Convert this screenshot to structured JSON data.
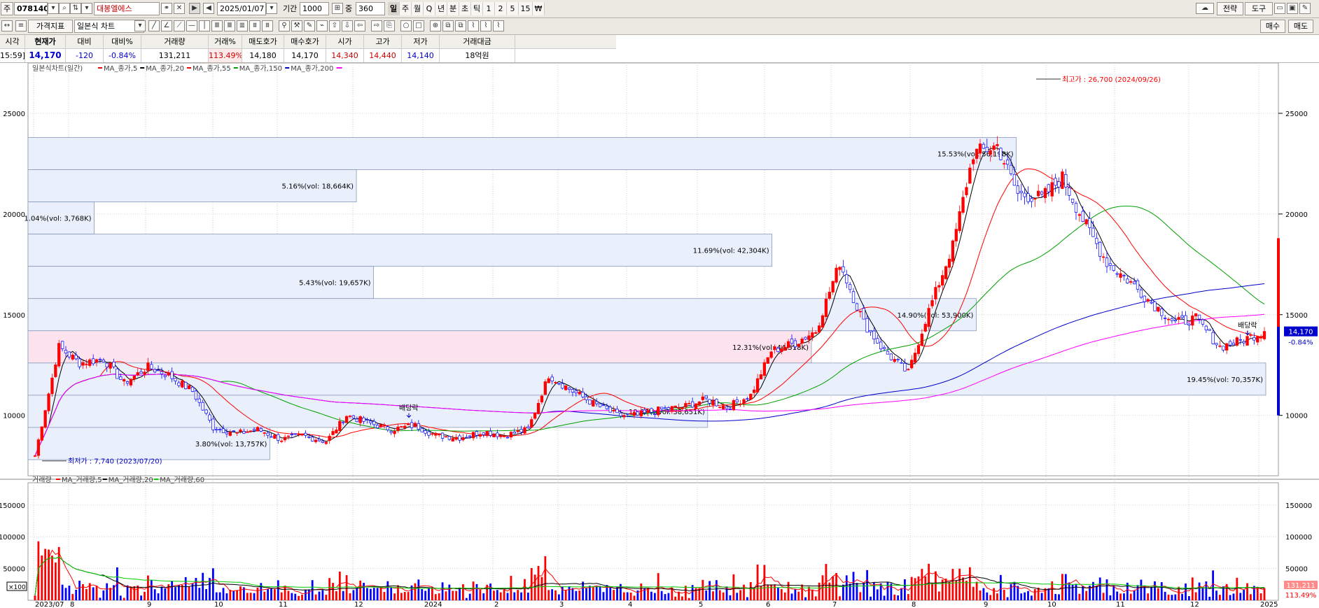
{
  "toolbar": {
    "market_label": "주",
    "code": "078140",
    "stock_name": "대봉엘에스",
    "date": "2025/01/07",
    "period_label": "기간",
    "period_value": "1000",
    "count_label": "중",
    "count_value": "360",
    "period_buttons": [
      "일",
      "주",
      "월",
      "Q",
      "년",
      "분",
      "초",
      "틱",
      "1",
      "2",
      "5",
      "15",
      "₩"
    ],
    "active_period": "일",
    "right_buttons": [
      "전략",
      "도구"
    ]
  },
  "toolbar2": {
    "indicator_label": "가격지표",
    "chart_type": "일본식 차트",
    "buy_label": "매수",
    "sell_label": "매도"
  },
  "quote": {
    "headers": [
      "시각",
      "현재가",
      "대비",
      "대비%",
      "거래량",
      "거래%",
      "매도호가",
      "매수호가",
      "시가",
      "고가",
      "저가",
      "거래대금"
    ],
    "values": [
      "15:59]",
      "14,170",
      "-120",
      "-0.84%",
      "131,211",
      "113.49%",
      "14,180",
      "14,170",
      "14,340",
      "14,440",
      "14,140",
      "18억원"
    ],
    "colors": [
      "#000000",
      "#0000cc",
      "#0000cc",
      "#0000cc",
      "#000000",
      "#cc0000",
      "#000000",
      "#000000",
      "#cc0000",
      "#cc0000",
      "#0000cc",
      "#000000"
    ]
  },
  "price_panel": {
    "title": "일본식차트(일간)",
    "legend": [
      {
        "label": "MA_종가,5",
        "color": "#ff0000"
      },
      {
        "label": "MA_종가,20",
        "color": "#000000"
      },
      {
        "label": "MA_종가,55",
        "color": "#ff0000"
      },
      {
        "label": "MA_종가,150",
        "color": "#00a000"
      },
      {
        "label": "MA_종가,200",
        "color": "#0000cc"
      }
    ],
    "last_series_color": "#ff00ff",
    "price_ticks": [
      "25000",
      "20000",
      "15000",
      "10000"
    ],
    "current_price_tag": "14,170",
    "current_change_tag": "-0.84%",
    "high_annotation": "최고가 : 26,700 (2024/09/26)",
    "low_annotation": "최저가 : 7,740 (2023/07/20)",
    "dividend_label": "배당락",
    "volume_profile": [
      {
        "text": "15.53%(vol: 56,198K)",
        "price_low": 22200,
        "price_high": 23800,
        "highlight": false
      },
      {
        "text": "5.16%(vol: 18,664K)",
        "price_low": 20600,
        "price_high": 22200,
        "highlight": false
      },
      {
        "text": "1.04%(vol: 3,768K)",
        "price_low": 19000,
        "price_high": 20600,
        "highlight": false
      },
      {
        "text": "11.69%(vol: 42,304K)",
        "price_low": 17400,
        "price_high": 19000,
        "highlight": false
      },
      {
        "text": "5.43%(vol: 19,657K)",
        "price_low": 15800,
        "price_high": 17400,
        "highlight": false
      },
      {
        "text": "14.90%(vol: 53,900K)",
        "price_low": 14200,
        "price_high": 15800,
        "highlight": false
      },
      {
        "text": "12.31%(vol: 44,518K)",
        "price_low": 12600,
        "price_high": 14200,
        "highlight": true
      },
      {
        "text": "19.45%(vol: 70,357K)",
        "price_low": 11000,
        "price_high": 12600,
        "highlight": false
      },
      {
        "text": "10.68%(vol: 38,651K)",
        "price_low": 9400,
        "price_high": 11000,
        "highlight": false
      },
      {
        "text": "3.80%(vol: 13,757K)",
        "price_low": 7800,
        "price_high": 9400,
        "highlight": false
      }
    ]
  },
  "volume_panel": {
    "title": "거래량",
    "legend": [
      {
        "label": "MA_거래량,5",
        "color": "#ff0000"
      },
      {
        "label": "MA_거래량,20",
        "color": "#000000"
      },
      {
        "label": "MA_거래량,60",
        "color": "#00cc00"
      }
    ],
    "unit_label": "×100",
    "volume_ticks": [
      "150000",
      "100000",
      "50000"
    ],
    "current_volume_tag": "131,211",
    "current_volume_pct_tag": "113.49%"
  },
  "x_axis": {
    "labels": [
      "2023/07",
      "8",
      "9",
      "10",
      "11",
      "12",
      "2024",
      "2",
      "3",
      "4",
      "5",
      "6",
      "7",
      "8",
      "9",
      "10",
      "11",
      "12",
      "2025"
    ]
  },
  "chart_data": {
    "type": "candlestick",
    "x_range": [
      "2023-07",
      "2025-01"
    ],
    "price_range": [
      7000,
      27500
    ],
    "price_ticks": [
      10000,
      15000,
      20000,
      25000
    ],
    "volume_ticks": [
      50000,
      100000,
      150000
    ],
    "volume_range": [
      0,
      185000
    ],
    "close_series": [
      {
        "date": "2023-07",
        "close": 8000
      },
      {
        "date": "2023-07b",
        "close": 13400
      },
      {
        "date": "2023-08",
        "close": 12600
      },
      {
        "date": "2023-08b",
        "close": 12800
      },
      {
        "date": "2023-08c",
        "close": 11600
      },
      {
        "date": "2023-09",
        "close": 12400
      },
      {
        "date": "2023-09b",
        "close": 12000
      },
      {
        "date": "2023-09c",
        "close": 11200
      },
      {
        "date": "2023-10",
        "close": 9400
      },
      {
        "date": "2023-10b",
        "close": 9100
      },
      {
        "date": "2023-10c",
        "close": 9300
      },
      {
        "date": "2023-11",
        "close": 8800
      },
      {
        "date": "2023-11b",
        "close": 9000
      },
      {
        "date": "2023-11c",
        "close": 8700
      },
      {
        "date": "2023-12",
        "close": 10000
      },
      {
        "date": "2023-12b",
        "close": 9600
      },
      {
        "date": "2024-01",
        "close": 9300
      },
      {
        "date": "2024-01b",
        "close": 9500
      },
      {
        "date": "2024-01c",
        "close": 9000
      },
      {
        "date": "2024-02",
        "close": 8900
      },
      {
        "date": "2024-02b",
        "close": 9200
      },
      {
        "date": "2024-02c",
        "close": 9000
      },
      {
        "date": "2024-03",
        "close": 9300
      },
      {
        "date": "2024-03b",
        "close": 12000
      },
      {
        "date": "2024-03c",
        "close": 11200
      },
      {
        "date": "2024-04",
        "close": 10600
      },
      {
        "date": "2024-04b",
        "close": 10000
      },
      {
        "date": "2024-05",
        "close": 10000
      },
      {
        "date": "2024-05b",
        "close": 10300
      },
      {
        "date": "2024-05c",
        "close": 10400
      },
      {
        "date": "2024-06",
        "close": 10800
      },
      {
        "date": "2024-06b",
        "close": 10400
      },
      {
        "date": "2024-06c",
        "close": 11000
      },
      {
        "date": "2024-07",
        "close": 13200
      },
      {
        "date": "2024-07b",
        "close": 13600
      },
      {
        "date": "2024-07c",
        "close": 14200
      },
      {
        "date": "2024-08",
        "close": 17600
      },
      {
        "date": "2024-08b",
        "close": 14600
      },
      {
        "date": "2024-08c",
        "close": 13200
      },
      {
        "date": "2024-08d",
        "close": 12100
      },
      {
        "date": "2024-09",
        "close": 15200
      },
      {
        "date": "2024-09b",
        "close": 18400
      },
      {
        "date": "2024-09c",
        "close": 23000
      },
      {
        "date": "2024-09d",
        "close": 23400
      },
      {
        "date": "2024-10",
        "close": 21000
      },
      {
        "date": "2024-10b",
        "close": 20800
      },
      {
        "date": "2024-10c",
        "close": 21800
      },
      {
        "date": "2024-10d",
        "close": 19400
      },
      {
        "date": "2024-11",
        "close": 17600
      },
      {
        "date": "2024-11b",
        "close": 16600
      },
      {
        "date": "2024-11c",
        "close": 15600
      },
      {
        "date": "2024-12",
        "close": 14600
      },
      {
        "date": "2024-12b",
        "close": 14800
      },
      {
        "date": "2024-12c",
        "close": 13400
      },
      {
        "date": "2024-12d",
        "close": 13700
      },
      {
        "date": "2025-01",
        "close": 14170
      }
    ]
  }
}
